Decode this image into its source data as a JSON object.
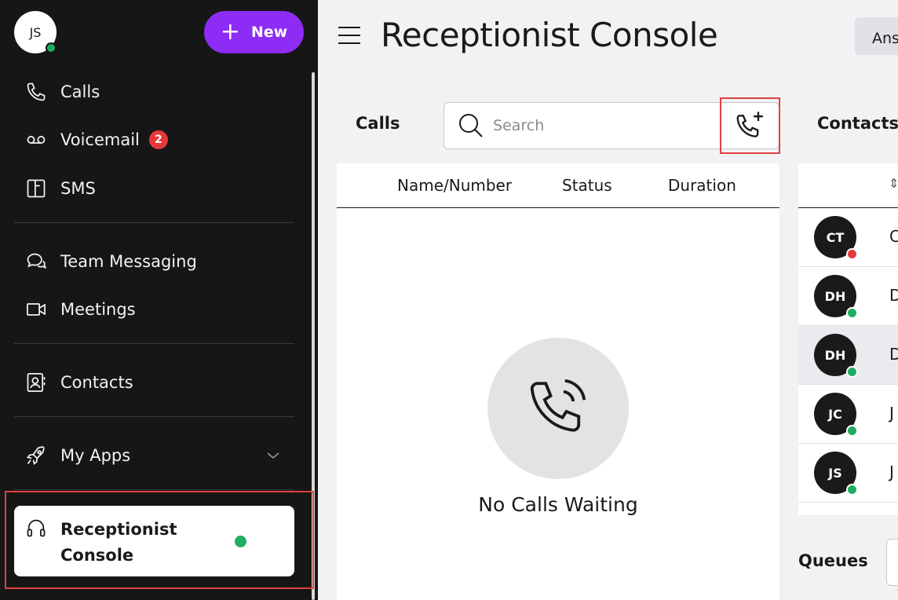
{
  "user": {
    "initials": "JS"
  },
  "new_button": {
    "label": "New"
  },
  "nav": {
    "calls": "Calls",
    "voicemail": "Voicemail",
    "voicemail_badge": "2",
    "sms": "SMS",
    "team_messaging": "Team Messaging",
    "meetings": "Meetings",
    "contacts": "Contacts",
    "my_apps": "My Apps",
    "receptionist_console": "Receptionist Console"
  },
  "header": {
    "title": "Receptionist Console",
    "answer_button": "Answer"
  },
  "calls_panel": {
    "label": "Calls",
    "search_placeholder": "Search",
    "columns": [
      "Name/Number",
      "Status",
      "Duration"
    ],
    "empty_text": "No Calls Waiting"
  },
  "contacts_panel": {
    "label": "Contacts",
    "rows": [
      {
        "initials": "CT",
        "name": "C",
        "presence": "#e5383b"
      },
      {
        "initials": "DH",
        "name": "D",
        "presence": "#1fae62"
      },
      {
        "initials": "DH",
        "name": "D",
        "presence": "#1fae62",
        "selected": true
      },
      {
        "initials": "JC",
        "name": "J",
        "presence": "#1fae62"
      },
      {
        "initials": "JS",
        "name": "J",
        "presence": "#1fae62"
      }
    ]
  },
  "queues_panel": {
    "label": "Queues"
  },
  "colors": {
    "sidebar_bg": "#161616",
    "accent": "#8c2cf5",
    "online": "#1fae62",
    "busy": "#e5383b",
    "highlight": "#e04141"
  }
}
